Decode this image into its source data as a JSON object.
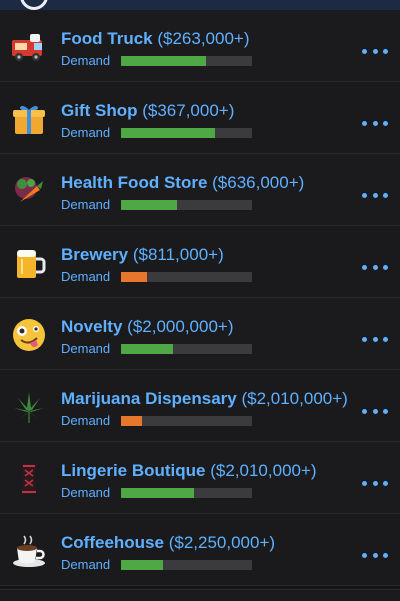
{
  "header": {
    "title": ""
  },
  "demand_label": "Demand",
  "colors": {
    "accent": "#5fb0ff",
    "high": "#4fa845",
    "low": "#e8772e",
    "track": "#3b3b3f"
  },
  "businesses": [
    {
      "name": "Food Truck",
      "price": "($263,000+)",
      "icon": "food-truck-icon",
      "demand": 0.65,
      "level": "high"
    },
    {
      "name": "Gift Shop",
      "price": "($367,000+)",
      "icon": "gift-icon",
      "demand": 0.72,
      "level": "high"
    },
    {
      "name": "Health Food Store",
      "price": "($636,000+)",
      "icon": "vegetables-icon",
      "demand": 0.43,
      "level": "high"
    },
    {
      "name": "Brewery",
      "price": "($811,000+)",
      "icon": "beer-mug-icon",
      "demand": 0.2,
      "level": "low"
    },
    {
      "name": "Novelty",
      "price": "($2,000,000+)",
      "icon": "zany-face-icon",
      "demand": 0.4,
      "level": "high"
    },
    {
      "name": "Marijuana Dispensary",
      "price": "($2,010,000+)",
      "icon": "cannabis-leaf-icon",
      "demand": 0.16,
      "level": "low"
    },
    {
      "name": "Lingerie Boutique",
      "price": "($2,010,000+)",
      "icon": "corset-icon",
      "demand": 0.56,
      "level": "high"
    },
    {
      "name": "Coffeehouse",
      "price": "($2,250,000+)",
      "icon": "coffee-cup-icon",
      "demand": 0.32,
      "level": "high"
    }
  ]
}
